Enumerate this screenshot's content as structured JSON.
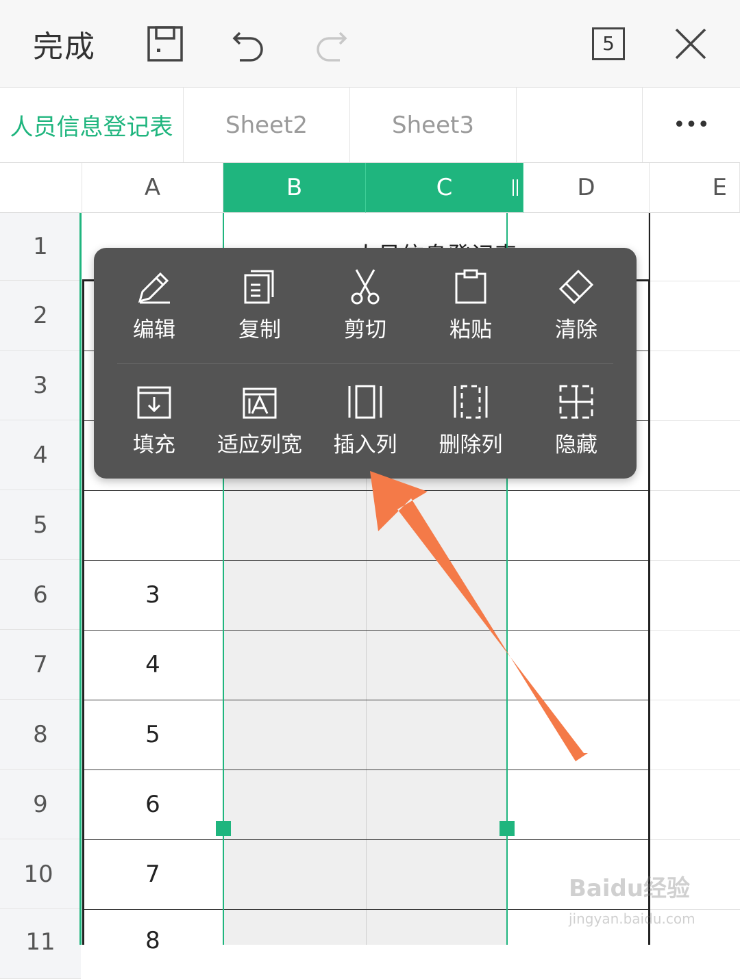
{
  "toolbar": {
    "done_label": "完成",
    "badge_count": "5",
    "icons": [
      "save-icon",
      "undo-icon",
      "redo-icon",
      "window-count-icon",
      "close-icon"
    ]
  },
  "tabs": [
    {
      "label": "人员信息登记表",
      "active": true
    },
    {
      "label": "Sheet2",
      "active": false
    },
    {
      "label": "Sheet3",
      "active": false
    },
    {
      "label": "•••",
      "active": false
    }
  ],
  "columns": [
    "A",
    "B",
    "C",
    "D",
    "E"
  ],
  "selected_columns": [
    "B",
    "C"
  ],
  "rows": [
    "1",
    "2",
    "3",
    "4",
    "5",
    "6",
    "7",
    "8",
    "9",
    "10",
    "11"
  ],
  "title_cell": "人员信息登记表",
  "col_a_values": [
    "",
    "",
    "",
    "",
    "",
    "3",
    "4",
    "5",
    "6",
    "7",
    "8"
  ],
  "menu": {
    "row1": [
      {
        "label": "编辑",
        "icon": "pencil-icon"
      },
      {
        "label": "复制",
        "icon": "copy-icon"
      },
      {
        "label": "剪切",
        "icon": "scissors-icon"
      },
      {
        "label": "粘贴",
        "icon": "clipboard-icon"
      },
      {
        "label": "清除",
        "icon": "eraser-icon"
      }
    ],
    "row2": [
      {
        "label": "填充",
        "icon": "fill-icon"
      },
      {
        "label": "适应列宽",
        "icon": "fit-width-icon"
      },
      {
        "label": "插入列",
        "icon": "insert-column-icon"
      },
      {
        "label": "删除列",
        "icon": "delete-column-icon"
      },
      {
        "label": "隐藏",
        "icon": "hide-icon"
      }
    ]
  },
  "colors": {
    "accent": "#1fb57e",
    "menu_bg": "#545454",
    "arrow": "#f47a48"
  },
  "watermark": {
    "main": "Baidu经验",
    "sub": "jingyan.baidu.com"
  }
}
